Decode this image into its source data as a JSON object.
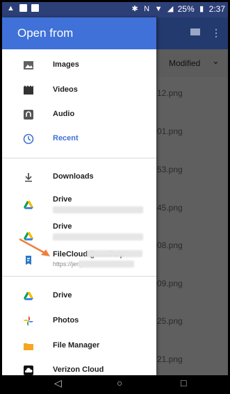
{
  "status_bar": {
    "battery": "25%",
    "time": "2:37"
  },
  "drawer": {
    "title": "Open from",
    "items": [
      {
        "label": "Images",
        "icon": "image-icon"
      },
      {
        "label": "Videos",
        "icon": "video-icon"
      },
      {
        "label": "Audio",
        "icon": "audio-icon"
      },
      {
        "label": "Recent",
        "icon": "clock-icon"
      },
      {
        "label": "Downloads",
        "icon": "download-icon"
      },
      {
        "label": "Drive",
        "icon": "drive-icon"
      },
      {
        "label": "Drive",
        "icon": "drive-icon"
      },
      {
        "label": "FileCloud (jenniferp",
        "sub": "https://jenp",
        "icon": "filecloud-icon"
      },
      {
        "label": "Drive",
        "icon": "drive-icon"
      },
      {
        "label": "Photos",
        "icon": "photos-icon"
      },
      {
        "label": "File Manager",
        "icon": "folder-icon"
      },
      {
        "label": "Verizon Cloud",
        "icon": "cloud-icon"
      }
    ],
    "colors": {
      "accent": "#3f71d8",
      "recent": "#3f71d8"
    }
  },
  "background": {
    "sort_label": "Modified",
    "files": [
      "12.png",
      "01.png",
      "53.png",
      "45.png",
      "08.png",
      "09.png",
      "25.png",
      "21.png"
    ]
  }
}
